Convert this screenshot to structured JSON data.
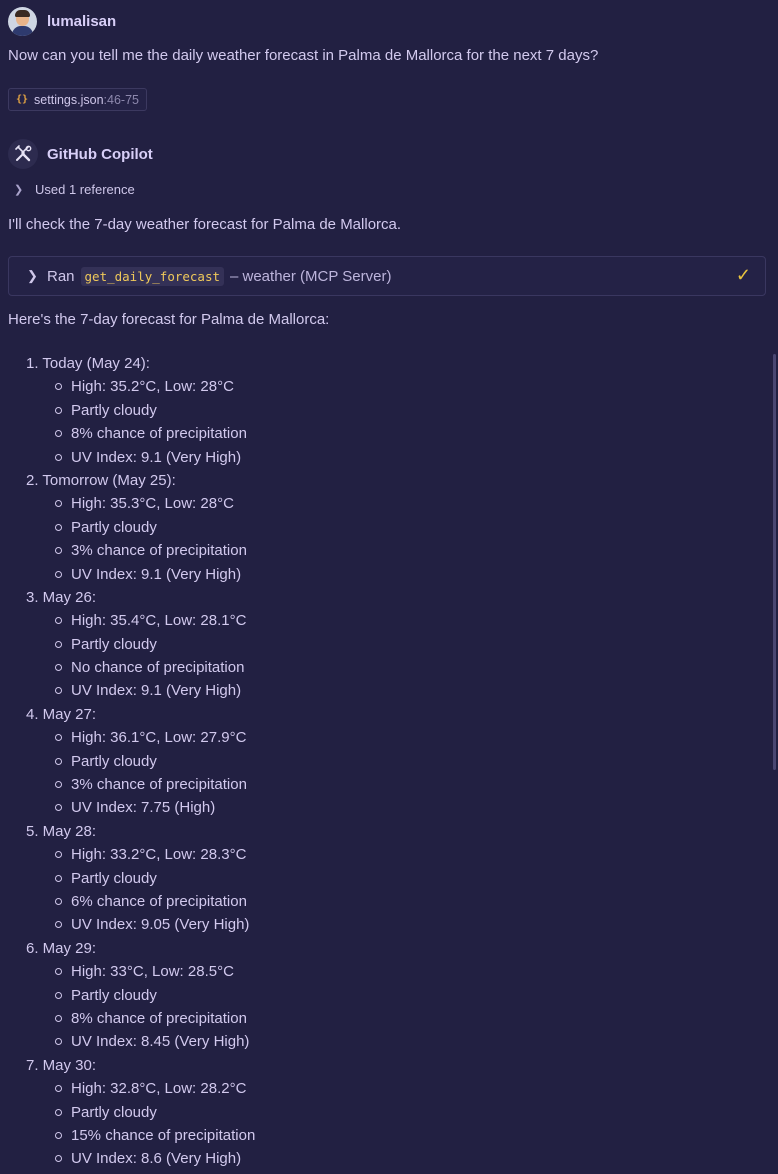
{
  "user": {
    "name": "lumalisan",
    "message": "Now can you tell me the daily weather forecast in Palma de Mallorca for the next 7 days?"
  },
  "reference_chip": {
    "file": "settings.json",
    "range": ":46-75"
  },
  "assistant": {
    "name": "GitHub Copilot",
    "used_refs": "Used 1 reference",
    "intro": "I'll check the 7-day weather forecast for Palma de Mallorca.",
    "tool": {
      "ran": "Ran",
      "name": "get_daily_forecast",
      "server": "– weather (MCP Server)"
    },
    "summary": "Here's the 7-day forecast for Palma de Mallorca:"
  },
  "forecast": [
    {
      "title": "1. Today (May 24):",
      "items": [
        "High: 35.2°C, Low: 28°C",
        "Partly cloudy",
        "8% chance of precipitation",
        "UV Index: 9.1 (Very High)"
      ]
    },
    {
      "title": "2. Tomorrow (May 25):",
      "items": [
        "High: 35.3°C, Low: 28°C",
        "Partly cloudy",
        "3% chance of precipitation",
        "UV Index: 9.1 (Very High)"
      ]
    },
    {
      "title": "3. May 26:",
      "items": [
        "High: 35.4°C, Low: 28.1°C",
        "Partly cloudy",
        "No chance of precipitation",
        "UV Index: 9.1 (Very High)"
      ]
    },
    {
      "title": "4. May 27:",
      "items": [
        "High: 36.1°C, Low: 27.9°C",
        "Partly cloudy",
        "3% chance of precipitation",
        "UV Index: 7.75 (High)"
      ]
    },
    {
      "title": "5. May 28:",
      "items": [
        "High: 33.2°C, Low: 28.3°C",
        "Partly cloudy",
        "6% chance of precipitation",
        "UV Index: 9.05 (Very High)"
      ]
    },
    {
      "title": "6. May 29:",
      "items": [
        "High: 33°C, Low: 28.5°C",
        "Partly cloudy",
        "8% chance of precipitation",
        "UV Index: 8.45 (Very High)"
      ]
    },
    {
      "title": "7. May 30:",
      "items": [
        "High: 32.8°C, Low: 28.2°C",
        "Partly cloudy",
        "15% chance of precipitation",
        "UV Index: 8.6 (Very High)"
      ]
    }
  ],
  "colors": {
    "background": "#222042",
    "text": "#d2c9ee",
    "code": "#f0c95a",
    "check": "#e8c33e"
  }
}
